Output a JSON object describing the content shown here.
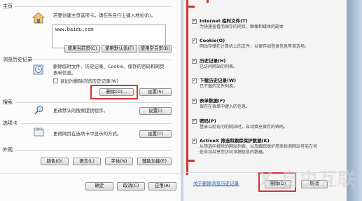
{
  "left": {
    "homepage": {
      "title": "主页",
      "desc": "若要创建主页选项卡，请在各自行上键入地址(R)。",
      "url": "www.baidu.com",
      "buttons": [
        "使用当前页(C)",
        "使用默认值(F)",
        "使用空白页(B)"
      ]
    },
    "history": {
      "title": "浏览历史记录",
      "desc_line1": "删除临时文件、历史记录、Cookie、保存的密码和网页",
      "desc_line2": "表单信息。",
      "checkbox_label": "退出时删除浏览历史记录(W)",
      "checkbox_checked": false,
      "delete_label": "删除(D)...",
      "settings_label": "设置(S)"
    },
    "search": {
      "title": "搜索",
      "desc": "更改默认的搜索提供程序。",
      "settings_label": "设置(I)"
    },
    "tabs": {
      "title": "选项卡",
      "desc": "更改网页在选项卡中显示的方式。",
      "settings_label": "设置(T)"
    },
    "appearance": {
      "title": "外观",
      "buttons": [
        "颜色(O)",
        "语言(L)",
        "字体(N)",
        "辅助功能(E)"
      ]
    },
    "footer": {
      "ok": "确定",
      "cancel": "取消(C)",
      "apply": "应用(A)"
    }
  },
  "right": {
    "options": [
      {
        "title": "Internet 临时文件(T)",
        "desc1": "为快速查看而保存的网页、图像和媒体的副本",
        "desc2": "",
        "checked": true
      },
      {
        "title": "Cookie(O)",
        "desc1": "网站存储在计算机上的文件，以保存如登录信息等首选项。",
        "desc2": "",
        "checked": true
      },
      {
        "title": "历史记录(H)",
        "desc1": "已访问网站的列表。",
        "desc2": "",
        "checked": true
      },
      {
        "title": "下载历史记录(W)",
        "desc1": "已下载的文件列表。",
        "desc2": "",
        "checked": true
      },
      {
        "title": "表单数据(F)",
        "desc1": "保存在表单中键入的信息。",
        "desc2": "",
        "checked": true
      },
      {
        "title": "密码(P)",
        "desc1": "登录以前访问的网站时，自动填充保存的密码。",
        "desc2": "",
        "checked": true
      },
      {
        "title": "ActiveX 筛选和跟踪保护数据(K)",
        "desc1": "从筛选中排除的网站列表，以及跟踪保护用来检测网站可能在何",
        "desc2": "处自动共享您访问详细信息的数据。",
        "checked": true
      }
    ],
    "link": "关于删除浏览历史记录",
    "delete_label": "删除(D)",
    "cancel_label": "取消"
  },
  "watermark": "X 自由互联",
  "colors": {
    "highlight": "#d9322e",
    "link": "#1a5fb4"
  }
}
